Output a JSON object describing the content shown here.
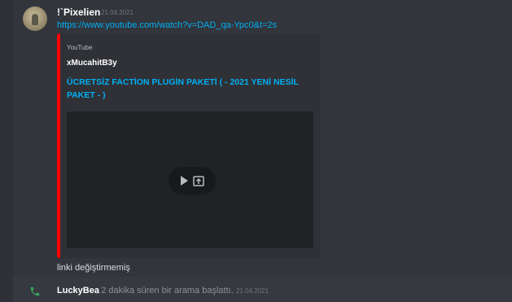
{
  "message": {
    "author": "!`Pixelien",
    "timestamp": "21.04.2021",
    "link": "https://www.youtube.com/watch?v=DAD_qa-Ypc0&t=2s",
    "text": "linki değiştirmemiş"
  },
  "embed": {
    "provider": "YouTube",
    "author": "xMucahitB3y",
    "title": "ÜCRETSİZ FACTİON PLUGİN PAKETİ ( - 2021 YENİ NESİL PAKET - )",
    "accent_color": "#ff0000",
    "icons": {
      "play": "play-icon",
      "open": "open-external-icon"
    }
  },
  "call": {
    "user": "LuckyBea",
    "text": ", 2 dakika süren bir arama başlattı.",
    "timestamp": "21.04.2021",
    "icon": "phone-icon",
    "icon_color": "#3ba55c"
  }
}
